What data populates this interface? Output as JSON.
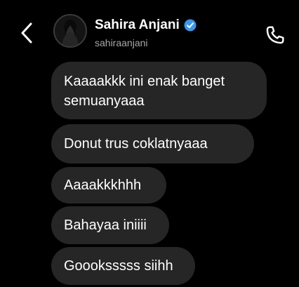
{
  "header": {
    "contact_name": "Sahira Anjani",
    "contact_handle": "sahiraanjani",
    "back_icon": "chevron-left-icon",
    "verified_icon": "verified-badge-icon",
    "call_icon": "phone-icon"
  },
  "messages": [
    {
      "line1": "Kaaaakkk ini enak banget",
      "line2": "semuanyaaa"
    },
    {
      "text": "Donut trus coklatnyaaa"
    },
    {
      "text": "Aaaakkkhhh"
    },
    {
      "text": "Bahayaa iniiii"
    },
    {
      "text": "Goooksssss siihh"
    }
  ],
  "colors": {
    "background": "#000000",
    "bubble": "#262626",
    "verified": "#3897f0",
    "secondary_text": "#a8a8a8"
  }
}
